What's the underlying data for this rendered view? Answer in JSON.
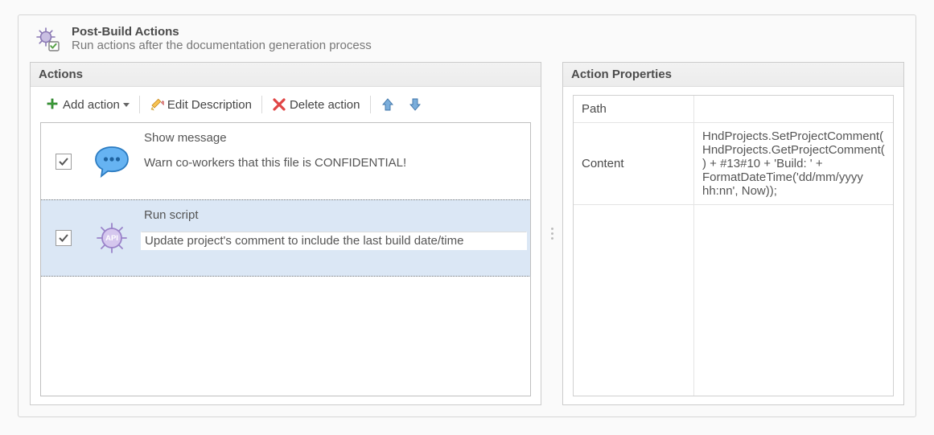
{
  "header": {
    "title": "Post-Build Actions",
    "subtitle": "Run actions after the documentation generation process"
  },
  "sections": {
    "actions_title": "Actions",
    "properties_title": "Action Properties"
  },
  "toolbar": {
    "add_action": "Add action",
    "edit_description": "Edit Description",
    "delete_action": "Delete action"
  },
  "actions": [
    {
      "type": "Show message",
      "desc": "Warn co-workers that this file is CONFIDENTIAL!",
      "checked": true,
      "selected": false,
      "icon": "speech-icon"
    },
    {
      "type": "Run script",
      "desc": "Update project's comment to include the last build date/time",
      "checked": true,
      "selected": true,
      "icon": "api-gear-icon"
    }
  ],
  "properties": [
    {
      "name": "Path",
      "value": ""
    },
    {
      "name": "Content",
      "value": "HndProjects.SetProjectComment(HndProjects.GetProjectComment() + #13#10 + 'Build: ' + FormatDateTime('dd/mm/yyyy hh:nn', Now));"
    }
  ]
}
